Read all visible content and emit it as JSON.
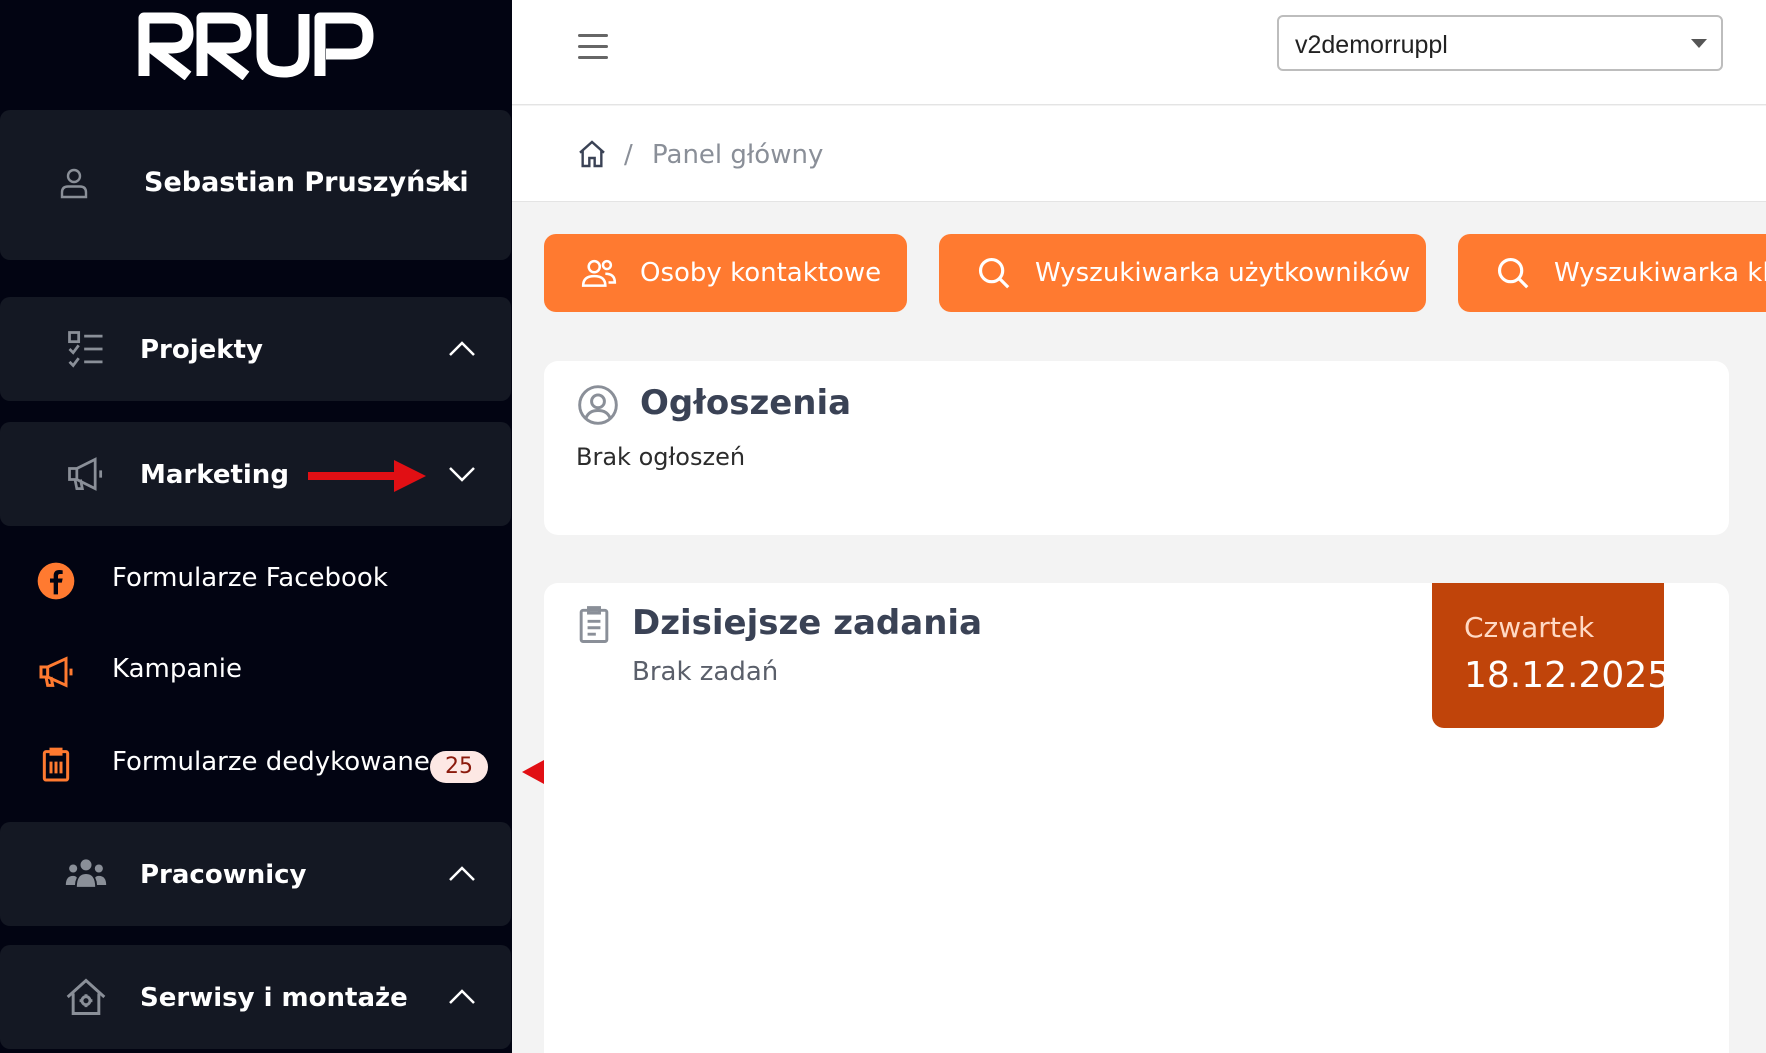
{
  "app": {
    "logo_text": "RRUP"
  },
  "sidebar": {
    "user": {
      "name": "Sebastian Pruszyński"
    },
    "sections": {
      "projekty": {
        "label": "Projekty"
      },
      "marketing": {
        "label": "Marketing",
        "items": [
          {
            "label": "Formularze Facebook"
          },
          {
            "label": "Kampanie"
          },
          {
            "label": "Formularze dedykowane",
            "badge": "25"
          }
        ]
      },
      "pracownicy": {
        "label": "Pracownicy"
      },
      "serwisy": {
        "label": "Serwisy i montaże"
      }
    }
  },
  "topbar": {
    "select": {
      "value": "v2demorruppl"
    }
  },
  "breadcrumb": {
    "separator": "/",
    "current": "Panel główny"
  },
  "quick_actions": [
    {
      "label": "Osoby kontaktowe",
      "icon": "users-icon"
    },
    {
      "label": "Wyszukiwarka użytkowników",
      "icon": "search-icon"
    },
    {
      "label": "Wyszukiwarka klientów",
      "icon": "search-icon"
    }
  ],
  "announcements": {
    "title": "Ogłoszenia",
    "empty_text": "Brak ogłoszeń"
  },
  "tasks": {
    "title": "Dzisiejsze zadania",
    "empty_text": "Brak zadań",
    "day": "Czwartek",
    "date": "18.12.2025"
  },
  "colors": {
    "sidebar_bg": "#020412",
    "panel_bg": "#141823",
    "accent_orange": "#ff7a30",
    "date_box": "#c0440a",
    "annotation_red": "#e10f14"
  }
}
